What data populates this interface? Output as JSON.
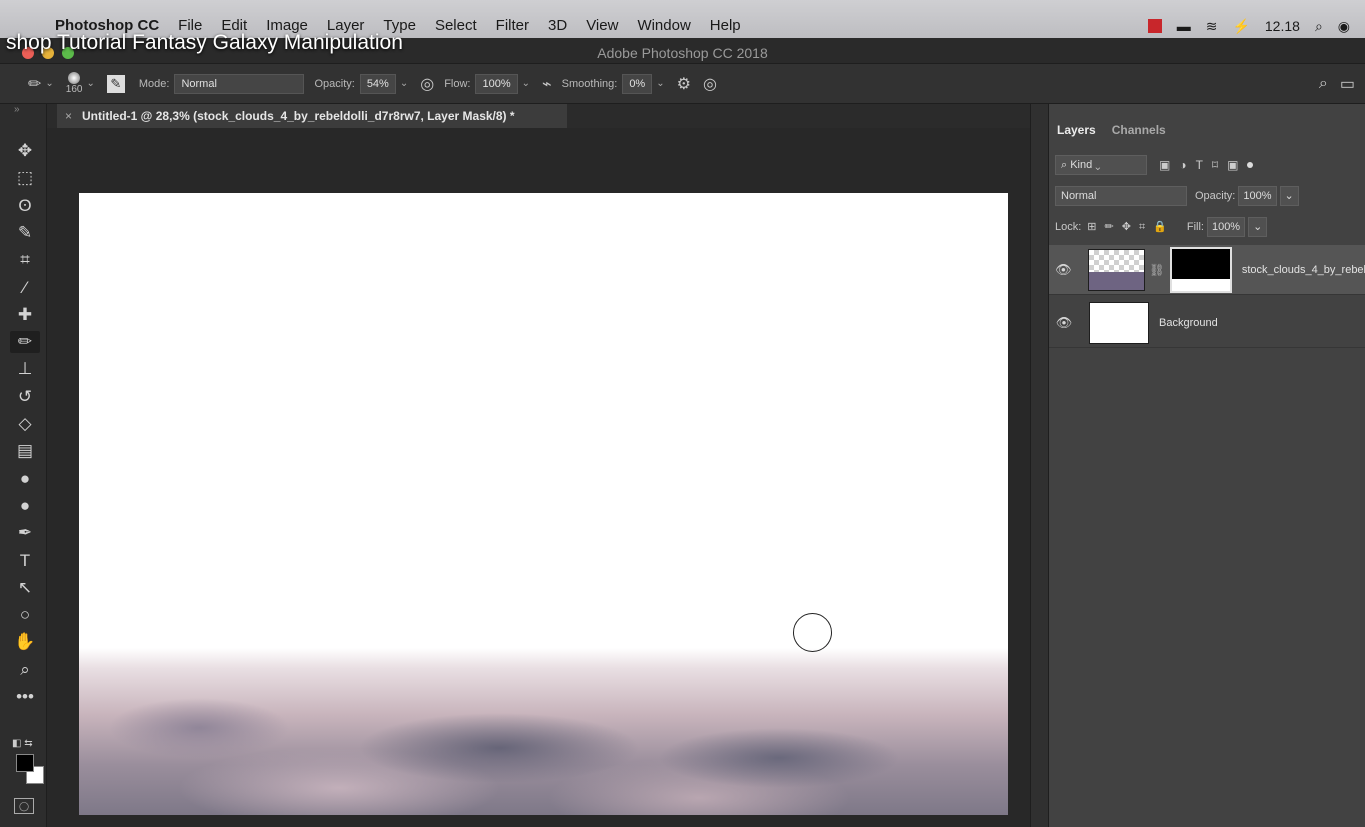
{
  "menubar": {
    "app": "Photoshop CC",
    "items": [
      "File",
      "Edit",
      "Image",
      "Layer",
      "Type",
      "Select",
      "Filter",
      "3D",
      "View",
      "Window",
      "Help"
    ],
    "clock": "12.18"
  },
  "video_title": "shop Tutorial Fantasy Galaxy Manipulation",
  "window_title": "Adobe Photoshop CC 2018",
  "options": {
    "brush_size": "160",
    "mode_label": "Mode:",
    "mode_value": "Normal",
    "opacity_label": "Opacity:",
    "opacity_value": "54%",
    "flow_label": "Flow:",
    "flow_value": "100%",
    "smoothing_label": "Smoothing:",
    "smoothing_value": "0%"
  },
  "document_tab": {
    "close": "×",
    "title": "Untitled-1 @ 28,3% (stock_clouds_4_by_rebeldolli_d7r8rw7, Layer Mask/8) *"
  },
  "tools": [
    {
      "name": "move-tool",
      "glyph": "✥",
      "active": false
    },
    {
      "name": "marquee-tool",
      "glyph": "⬚",
      "active": false
    },
    {
      "name": "lasso-tool",
      "glyph": "ʘ",
      "active": false
    },
    {
      "name": "quick-selection-tool",
      "glyph": "✎",
      "active": false
    },
    {
      "name": "crop-tool",
      "glyph": "⌗",
      "active": false
    },
    {
      "name": "eyedropper-tool",
      "glyph": "⁄",
      "active": false
    },
    {
      "name": "healing-brush-tool",
      "glyph": "✚",
      "active": false
    },
    {
      "name": "brush-tool",
      "glyph": "✏",
      "active": true
    },
    {
      "name": "clone-stamp-tool",
      "glyph": "⊥",
      "active": false
    },
    {
      "name": "history-brush-tool",
      "glyph": "↺",
      "active": false
    },
    {
      "name": "eraser-tool",
      "glyph": "◇",
      "active": false
    },
    {
      "name": "gradient-tool",
      "glyph": "▤",
      "active": false
    },
    {
      "name": "blur-tool",
      "glyph": "●",
      "active": false
    },
    {
      "name": "dodge-tool",
      "glyph": "●",
      "active": false
    },
    {
      "name": "pen-tool",
      "glyph": "✒",
      "active": false
    },
    {
      "name": "type-tool",
      "glyph": "T",
      "active": false
    },
    {
      "name": "path-selection-tool",
      "glyph": "↖",
      "active": false
    },
    {
      "name": "ellipse-tool",
      "glyph": "○",
      "active": false
    },
    {
      "name": "hand-tool",
      "glyph": "✋",
      "active": false
    },
    {
      "name": "zoom-tool",
      "glyph": "⌕",
      "active": false
    },
    {
      "name": "edit-toolbar",
      "glyph": "•••",
      "active": false
    }
  ],
  "panel": {
    "tabs": [
      "Layers",
      "Channels"
    ],
    "filter_kind": "Kind",
    "blend_mode": "Normal",
    "opacity_label": "Opacity:",
    "opacity_value": "100%",
    "lock_label": "Lock:",
    "fill_label": "Fill:",
    "fill_value": "100%",
    "layers": [
      {
        "name": "stock_clouds_4_by_rebel",
        "selected": true
      },
      {
        "name": "Background",
        "selected": false
      }
    ]
  },
  "colors": {
    "foreground": "#000000",
    "background": "#ffffff"
  }
}
